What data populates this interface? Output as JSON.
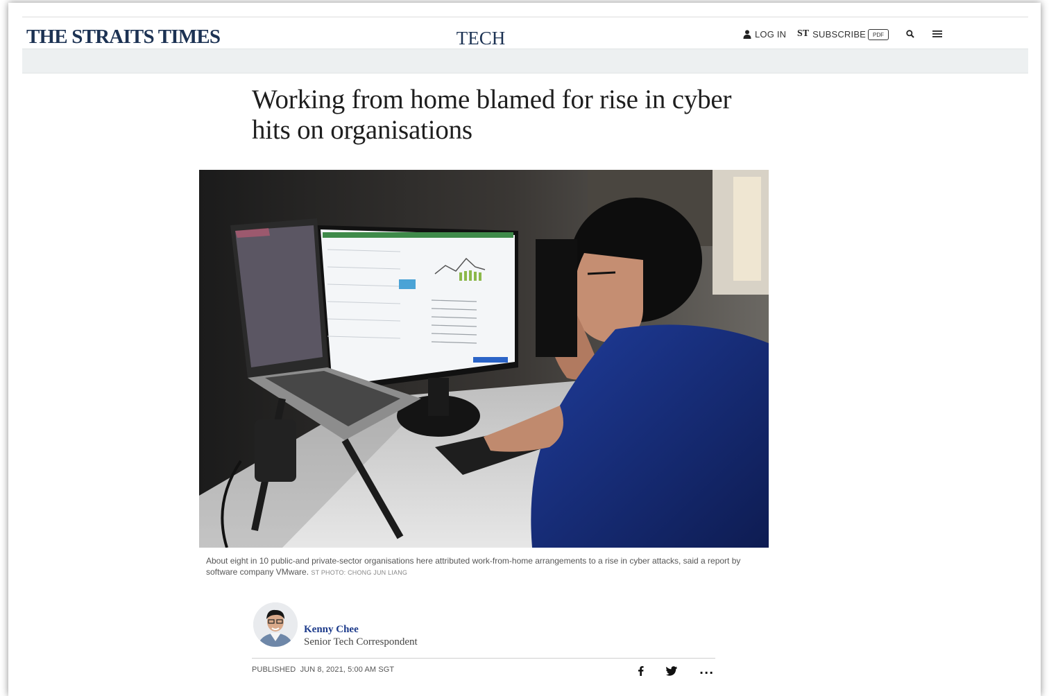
{
  "header": {
    "masthead": "THE STRAITS TIMES",
    "section": "TECH",
    "nav": {
      "login_label": "LOG IN",
      "subscribe_mark": "ST",
      "subscribe_label": "SUBSCRIBE",
      "pdf_label": "PDF"
    }
  },
  "article": {
    "headline": "Working from home blamed for rise in cyber hits on organisations",
    "caption": "About eight in 10 public-and private-sector organisations here attributed work-from-home arrangements to a rise in cyber attacks, said a report by software company VMware.",
    "photo_credit": "ST PHOTO: CHONG JUN LIANG",
    "author": {
      "name": "Kenny Chee",
      "title": "Senior Tech Correspondent"
    },
    "published": "PUBLISHED  JUN 8, 2021, 5:00 AM SGT",
    "share": {
      "more_label": "···"
    }
  },
  "icons": {
    "login": "user-icon",
    "search": "search-icon",
    "menu": "hamburger-menu-icon",
    "facebook": "facebook-icon",
    "twitter": "twitter-icon",
    "more": "more-options-icon"
  },
  "colors": {
    "brand_navy": "#1c3253",
    "author_link": "#1c3a8a",
    "band_grey": "#edf0f1"
  }
}
